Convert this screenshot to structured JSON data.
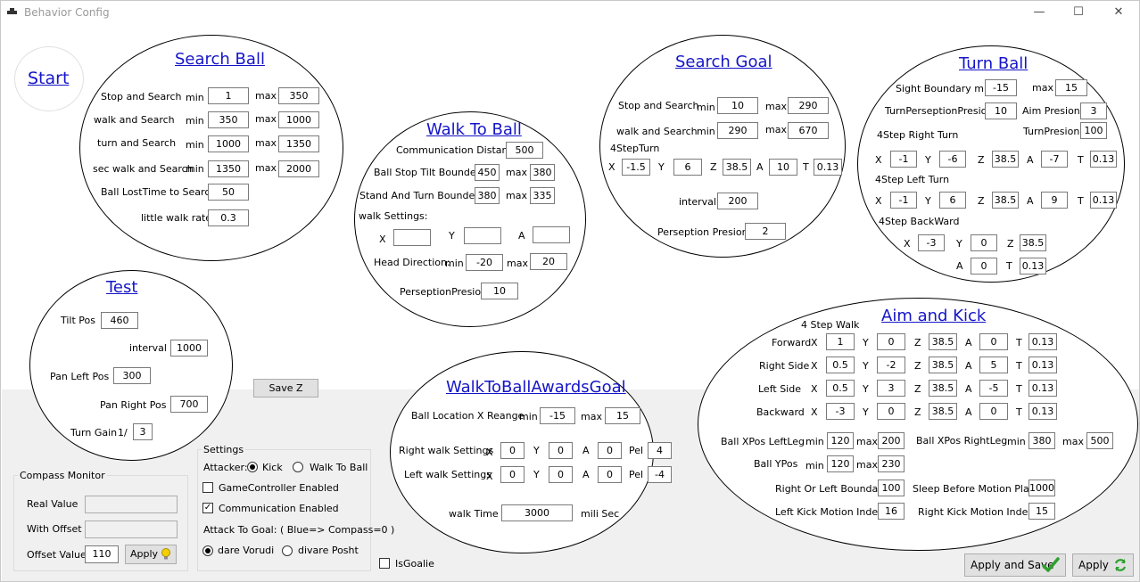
{
  "window": {
    "title": "Behavior Config",
    "minimize": "—",
    "maximize": "☐",
    "close": "✕"
  },
  "start": {
    "label": "Start"
  },
  "search_ball": {
    "title": "Search Ball",
    "rows": [
      {
        "label": "Stop and Search",
        "min_label": "min",
        "min": "1",
        "max_label": "max",
        "max": "350"
      },
      {
        "label": "walk and Search",
        "min_label": "min",
        "min": "350",
        "max_label": "max",
        "max": "1000"
      },
      {
        "label": "turn and Search",
        "min_label": "min",
        "min": "1000",
        "max_label": "max",
        "max": "1350"
      },
      {
        "label": "sec walk and Search",
        "min_label": "min",
        "min": "1350",
        "max_label": "max",
        "max": "2000"
      }
    ],
    "lost_label": "Ball LostTime to Search",
    "lost": "50",
    "rate_label": "little walk rate",
    "rate": "0.3"
  },
  "walk_to_ball": {
    "title": "Walk To Ball",
    "comm_label": "Communication Distance",
    "comm": "500",
    "tilt_label": "Ball Stop Tilt Bounder",
    "tilt": "450",
    "tilt_max_label": "max",
    "tilt_max": "380",
    "stand_label": "Stand And Turn Bounder",
    "stand": "380",
    "stand_max_label": "max",
    "stand_max": "335",
    "ws_label": "walk Settings:",
    "x_label": "X",
    "x": "",
    "y_label": "Y",
    "y": "",
    "a_label": "A",
    "a": "",
    "head_label": "Head Direction:",
    "head_min_label": "min",
    "head_min": "-20",
    "head_max_label": "max",
    "head_max": "20",
    "pp_label": "PerseptionPresion",
    "pp": "10"
  },
  "search_goal": {
    "title": "Search Goal",
    "stop_label": "Stop and Search",
    "stop_min_label": "min",
    "stop_min": "10",
    "stop_max_label": "max",
    "stop_max": "290",
    "walk_label": "walk and Search",
    "walk_min_label": "min",
    "walk_min": "290",
    "walk_max_label": "max",
    "walk_max": "670",
    "turn_label": "4StepTurn",
    "x_label": "X",
    "x": "-1.5",
    "y_label": "Y",
    "y": "6",
    "z_label": "Z",
    "z": "38.5",
    "a_label": "A",
    "a": "10",
    "t_label": "T",
    "t": "0.13",
    "interval_label": "interval",
    "interval": "200",
    "pp_label": "Perseption Presion",
    "pp": "2"
  },
  "turn_ball": {
    "title": "Turn Ball",
    "sight_label": "Sight Boundary min",
    "sight_min": "-15",
    "sight_max_label": "max",
    "sight_max": "15",
    "tpp_label": "TurnPerseptionPresion",
    "tpp": "10",
    "aim_label": "Aim Presion",
    "aim": "3",
    "tp_label": "TurnPresion",
    "tp": "100",
    "right_label": "4Step Right Turn",
    "right": {
      "x": "-1",
      "y": "-6",
      "z": "38.5",
      "a": "-7",
      "t": "0.13"
    },
    "left_label": "4Step Left Turn",
    "left": {
      "x": "-1",
      "y": "6",
      "z": "38.5",
      "a": "9",
      "t": "0.13"
    },
    "back_label": "4Step BackWard",
    "back": {
      "x": "-3",
      "y": "0",
      "z": "38.5",
      "a": "0",
      "t": "0.13"
    },
    "lx": "X",
    "ly": "Y",
    "lz": "Z",
    "la": "A",
    "lt": "T"
  },
  "test": {
    "title": "Test",
    "tilt_label": "Tilt Pos",
    "tilt": "460",
    "interval_label": "interval",
    "interval": "1000",
    "panl_label": "Pan Left Pos",
    "panl": "300",
    "panr_label": "Pan Right Pos",
    "panr": "700",
    "gain_label": "Turn Gain",
    "gain_prefix": "1/",
    "gain": "3"
  },
  "save_z": {
    "label": "Save Z"
  },
  "awards_goal": {
    "title": "WalkToBallAwardsGoal",
    "loc_label": "Ball Location X Reange",
    "loc_min_label": "min",
    "loc_min": "-15",
    "loc_max_label": "max",
    "loc_max": "15",
    "right_label": "Right walk Settings",
    "right": {
      "x": "0",
      "y": "0",
      "a": "0",
      "pel": "4"
    },
    "left_label": "Left walk Settings",
    "left": {
      "x": "0",
      "y": "0",
      "a": "0",
      "pel": "-4"
    },
    "lx": "X",
    "ly": "Y",
    "la": "A",
    "lpel": "Pel",
    "time_label": "walk Time",
    "time": "3000",
    "time_unit": "mili Sec"
  },
  "aim_kick": {
    "title": "Aim and Kick",
    "step_label": "4 Step Walk",
    "rows": [
      {
        "label": "Forward",
        "x": "1",
        "y": "0",
        "z": "38.5",
        "a": "0",
        "t": "0.13"
      },
      {
        "label": "Right Side",
        "x": "0.5",
        "y": "-2",
        "z": "38.5",
        "a": "5",
        "t": "0.13"
      },
      {
        "label": "Left Side",
        "x": "0.5",
        "y": "3",
        "z": "38.5",
        "a": "-5",
        "t": "0.13"
      },
      {
        "label": "Backward",
        "x": "-3",
        "y": "0",
        "z": "38.5",
        "a": "0",
        "t": "0.13"
      }
    ],
    "lx": "X",
    "ly": "Y",
    "lz": "Z",
    "la": "A",
    "lt": "T",
    "bxl_label": "Ball XPos LeftLeg",
    "bxl_min_label": "min",
    "bxl_min": "120",
    "bxl_max_label": "max",
    "bxl_max": "200",
    "bxr_label": "Ball XPos RightLeg",
    "bxr_min_label": "min",
    "bxr_min": "380",
    "bxr_max_label": "max",
    "bxr_max": "500",
    "by_label": "Ball YPos",
    "by_min_label": "min",
    "by_min": "120",
    "by_max_label": "max",
    "by_max": "230",
    "rol_label": "Right Or Left Boundar",
    "rol": "100",
    "sleep_label": "Sleep Before Motion Play",
    "sleep": "1000",
    "lk_label": "Left Kick Motion Index",
    "lk": "16",
    "rk_label": "Right Kick Motion Index",
    "rk": "15"
  },
  "compass": {
    "title": "Compass Monitor",
    "real_label": "Real Value",
    "real": "",
    "offset_label": "With Offset",
    "offset": "",
    "ov_label": "Offset Value",
    "ov": "110",
    "apply_label": "Apply"
  },
  "settings": {
    "title": "Settings",
    "attacker_label": "Attacker:",
    "kick_label": "Kick",
    "wtb_label": "Walk To Ball",
    "gc_label": "GameController Enabled",
    "gc_checked": false,
    "comm_label": "Communication Enabled",
    "comm_checked": true,
    "goal_label": "Attack To Goal: ( Blue=> Compass=0 )",
    "dare_label": "dare Vorudi",
    "posht_label": "divare Posht"
  },
  "is_goalie": {
    "label": "IsGoalie",
    "checked": false
  },
  "apply_save": {
    "label": "Apply and Save"
  },
  "apply": {
    "label": "Apply"
  },
  "colors": {
    "heading": "#1515c8",
    "panel": "#f0f0f0",
    "button": "#e1e1e1",
    "check_green": "#2ea02e"
  }
}
